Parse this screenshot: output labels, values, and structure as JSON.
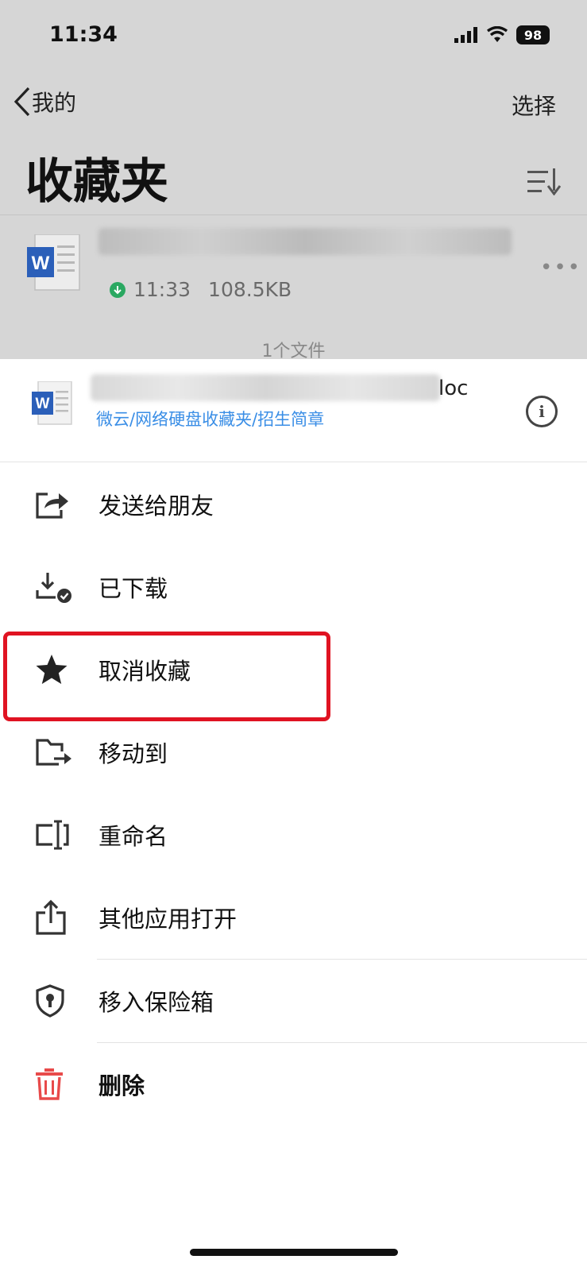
{
  "status_bar": {
    "time": "11:34",
    "battery": "98"
  },
  "nav": {
    "back_label": "我的",
    "select_label": "选择"
  },
  "page": {
    "title": "收藏夹"
  },
  "file": {
    "time": "11:33",
    "size": "108.5KB",
    "count_label": "1个文件"
  },
  "sheet": {
    "doc_suffix": "loc",
    "path": "微云/网络硬盘收藏夹/招生简章",
    "items": [
      {
        "label": "发送给朋友",
        "icon": "share-icon"
      },
      {
        "label": "已下载",
        "icon": "downloaded-icon"
      },
      {
        "label": "取消收藏",
        "icon": "star-icon"
      },
      {
        "label": "移动到",
        "icon": "move-folder-icon"
      },
      {
        "label": "重命名",
        "icon": "rename-icon"
      },
      {
        "label": "其他应用打开",
        "icon": "open-in-icon"
      },
      {
        "label": "移入保险箱",
        "icon": "vault-icon"
      },
      {
        "label": "删除",
        "icon": "trash-icon"
      }
    ]
  },
  "colors": {
    "accent_link": "#3a8ee6",
    "highlight": "#e01322",
    "danger": "#e84a4a",
    "word_blue": "#2b5fb9"
  }
}
